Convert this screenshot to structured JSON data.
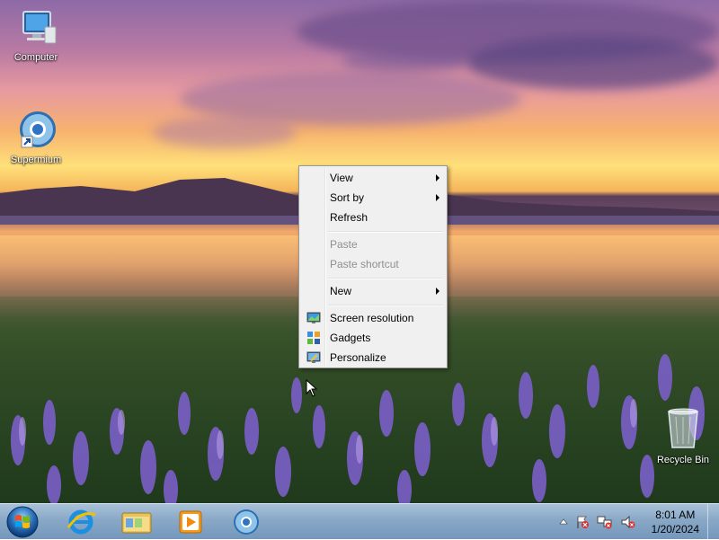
{
  "desktop": {
    "icons": [
      {
        "label": "Computer"
      },
      {
        "label": "Supermium"
      },
      {
        "label": "Recycle Bin"
      }
    ]
  },
  "context_menu": {
    "items": [
      {
        "label": "View",
        "submenu": true,
        "enabled": true
      },
      {
        "label": "Sort by",
        "submenu": true,
        "enabled": true
      },
      {
        "label": "Refresh",
        "enabled": true
      },
      {
        "label": "Paste",
        "enabled": false
      },
      {
        "label": "Paste shortcut",
        "enabled": false
      },
      {
        "label": "New",
        "submenu": true,
        "enabled": true
      },
      {
        "label": "Screen resolution",
        "icon": "display-icon",
        "enabled": true
      },
      {
        "label": "Gadgets",
        "icon": "gadgets-icon",
        "enabled": true
      },
      {
        "label": "Personalize",
        "icon": "personalize-icon",
        "enabled": true
      }
    ]
  },
  "taskbar": {
    "pinned": [
      {
        "icon": "internet-explorer-icon"
      },
      {
        "icon": "file-explorer-icon"
      },
      {
        "icon": "media-player-icon"
      },
      {
        "icon": "supermium-icon"
      }
    ],
    "tray": {
      "time": "8:01 AM",
      "date": "1/20/2024"
    }
  },
  "colors": {
    "taskbar": "#89a8c7",
    "menu_bg": "#f0f0f0",
    "disabled_text": "#8f8f8f"
  }
}
